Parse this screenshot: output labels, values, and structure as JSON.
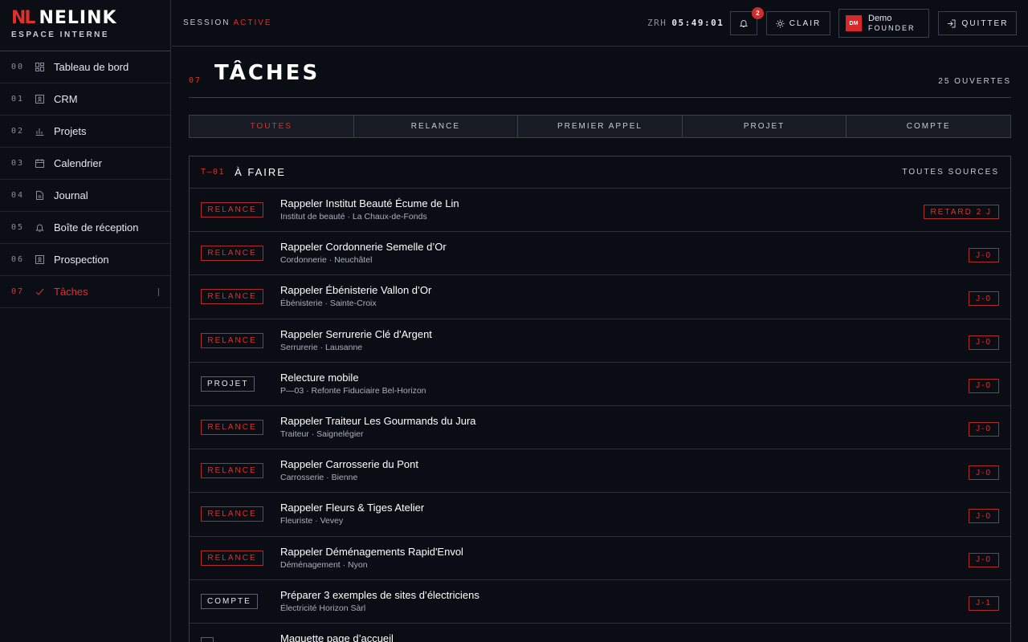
{
  "brand": {
    "mark": "NL",
    "name": "NELINK",
    "subtitle": "ESPACE INTERNE"
  },
  "sidebar": {
    "items": [
      {
        "num": "00",
        "icon": "dashboard-icon",
        "label": "Tableau de bord",
        "active": false
      },
      {
        "num": "01",
        "icon": "contact-card-icon",
        "label": "CRM",
        "active": false
      },
      {
        "num": "02",
        "icon": "chart-icon",
        "label": "Projets",
        "active": false
      },
      {
        "num": "03",
        "icon": "calendar-icon",
        "label": "Calendrier",
        "active": false
      },
      {
        "num": "04",
        "icon": "document-icon",
        "label": "Journal",
        "active": false
      },
      {
        "num": "05",
        "icon": "bell-icon",
        "label": "Boîte de réception",
        "active": false
      },
      {
        "num": "06",
        "icon": "contact-card-icon",
        "label": "Prospection",
        "active": false
      },
      {
        "num": "07",
        "icon": "check-icon",
        "label": "Tâches",
        "active": true
      }
    ]
  },
  "topbar": {
    "session_label": "SESSION",
    "session_status": "ACTIVE",
    "clock_zone": "ZRH",
    "clock_time": "05:49:01",
    "notification_count": "2",
    "theme_label": "CLAIR",
    "user_initials": "DM",
    "user_name": "Demo",
    "user_role": "FOUNDER",
    "quit_label": "QUITTER"
  },
  "page": {
    "num": "07",
    "title": "TÂCHES",
    "open_count": "25 OUVERTES"
  },
  "filters": [
    {
      "label": "TOUTES",
      "active": true
    },
    {
      "label": "RELANCE",
      "active": false
    },
    {
      "label": "PREMIER APPEL",
      "active": false
    },
    {
      "label": "PROJET",
      "active": false
    },
    {
      "label": "COMPTE",
      "active": false
    }
  ],
  "panel": {
    "code": "T—01",
    "title": "À FAIRE",
    "source": "TOUTES SOURCES"
  },
  "tasks": [
    {
      "tag": "RELANCE",
      "tag_type": "relance",
      "title": "Rappeler Institut Beauté Écume de Lin",
      "meta": "Institut de beauté · La Chaux-de-Fonds",
      "due": "RETARD 2 J"
    },
    {
      "tag": "RELANCE",
      "tag_type": "relance",
      "title": "Rappeler Cordonnerie Semelle d’Or",
      "meta": "Cordonnerie · Neuchâtel",
      "due": "J-0"
    },
    {
      "tag": "RELANCE",
      "tag_type": "relance",
      "title": "Rappeler Ébénisterie Vallon d’Or",
      "meta": "Ébénisterie · Sainte-Croix",
      "due": "J-0"
    },
    {
      "tag": "RELANCE",
      "tag_type": "relance",
      "title": "Rappeler Serrurerie Clé d'Argent",
      "meta": "Serrurerie · Lausanne",
      "due": "J-0"
    },
    {
      "tag": "PROJET",
      "tag_type": "neutral",
      "title": "Relecture mobile",
      "meta": "P—03 · Refonte Fiduciaire Bel-Horizon",
      "due": "J-0"
    },
    {
      "tag": "RELANCE",
      "tag_type": "relance",
      "title": "Rappeler Traiteur Les Gourmands du Jura",
      "meta": "Traiteur · Saignelégier",
      "due": "J-0"
    },
    {
      "tag": "RELANCE",
      "tag_type": "relance",
      "title": "Rappeler Carrosserie du Pont",
      "meta": "Carrosserie · Bienne",
      "due": "J-0"
    },
    {
      "tag": "RELANCE",
      "tag_type": "relance",
      "title": "Rappeler Fleurs & Tiges Atelier",
      "meta": "Fleuriste · Vevey",
      "due": "J-0"
    },
    {
      "tag": "RELANCE",
      "tag_type": "relance",
      "title": "Rappeler Déménagements Rapid'Envol",
      "meta": "Déménagement · Nyon",
      "due": "J-0"
    },
    {
      "tag": "COMPTE",
      "tag_type": "neutral",
      "title": "Préparer 3 exemples de sites d’électriciens",
      "meta": "Électricité Horizon Sàrl",
      "due": "J-1"
    },
    {
      "tag": "",
      "tag_type": "neutral",
      "title": "Maquette page d’accueil",
      "meta": "",
      "due": ""
    }
  ],
  "colors": {
    "accent": "#e0302a",
    "background": "#0a0d14",
    "border": "#3a404c"
  }
}
